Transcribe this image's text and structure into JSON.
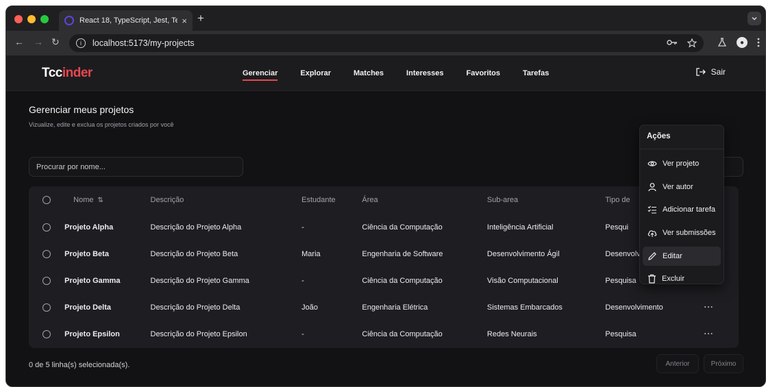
{
  "browser": {
    "tab_title": "React 18, TypeScript, Jest, Te",
    "tab_close": "×",
    "new_tab": "+",
    "url": "localhost:5173/my-projects"
  },
  "app": {
    "logo_prefix": "Tcc",
    "logo_accent": "inder",
    "nav": [
      "Gerenciar",
      "Explorar",
      "Matches",
      "Interesses",
      "Favoritos",
      "Tarefas"
    ],
    "logout": "Sair"
  },
  "page": {
    "title": "Gerenciar meus projetos",
    "subtitle": "Vizualize, edite e exclua os projetos criados por você",
    "search_placeholder": "Procurar por nome..."
  },
  "table": {
    "headers": {
      "nome": "Nome",
      "descricao": "Descrição",
      "estudante": "Estudante",
      "area": "Área",
      "subarea": "Sub-area",
      "tipo": "Tipo de"
    },
    "rows": [
      {
        "nome": "Projeto Alpha",
        "descricao": "Descrição do Projeto Alpha",
        "estudante": "-",
        "area": "Ciência da Computação",
        "subarea": "Inteligência Artificial",
        "tipo": "Pesqui",
        "acao": "···"
      },
      {
        "nome": "Projeto Beta",
        "descricao": "Descrição do Projeto Beta",
        "estudante": "Maria",
        "area": "Engenharia de Software",
        "subarea": "Desenvolvimento Ágil",
        "tipo": "Desenvolvimento",
        "acao": "···"
      },
      {
        "nome": "Projeto Gamma",
        "descricao": "Descrição do Projeto Gamma",
        "estudante": "-",
        "area": "Ciência da Computação",
        "subarea": "Visão Computacional",
        "tipo": "Pesquisa",
        "acao": "···"
      },
      {
        "nome": "Projeto Delta",
        "descricao": "Descrição do Projeto Delta",
        "estudante": "João",
        "area": "Engenharia Elétrica",
        "subarea": "Sistemas Embarcados",
        "tipo": "Desenvolvimento",
        "acao": "···"
      },
      {
        "nome": "Projeto Epsilon",
        "descricao": "Descrição do Projeto Epsilon",
        "estudante": "-",
        "area": "Ciência da Computação",
        "subarea": "Redes Neurais",
        "tipo": "Pesquisa",
        "acao": "···"
      }
    ]
  },
  "footer": {
    "selection": "0 de 5 linha(s) selecionada(s).",
    "prev": "Anterior",
    "next": "Próximo"
  },
  "menu": {
    "title": "Ações",
    "items": [
      "Ver projeto",
      "Ver autor",
      "Adicionar tarefa",
      "Ver submissões",
      "Editar",
      "Excluir"
    ]
  },
  "colors": {
    "accent": "#e5484d",
    "background": "#121214",
    "surface": "#1e1e22"
  }
}
